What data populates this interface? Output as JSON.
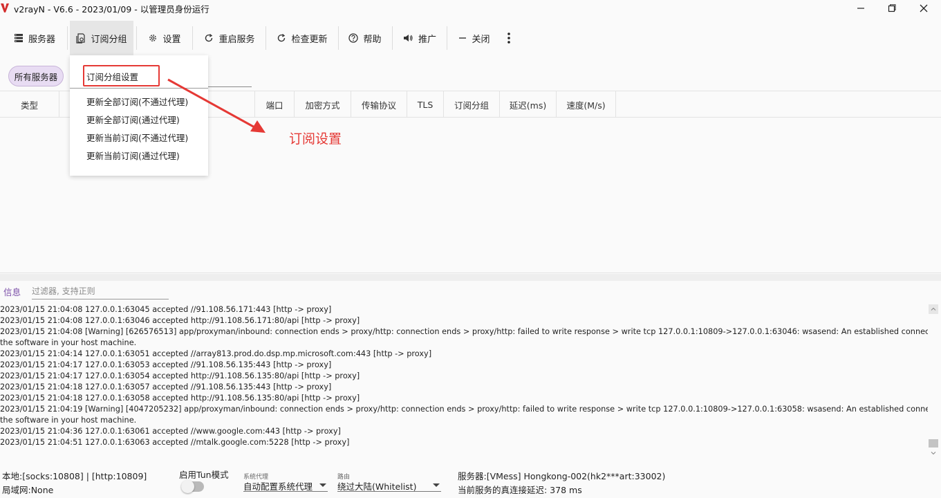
{
  "window": {
    "title": "v2rayN - V6.6 - 2023/01/09 - 以管理员身份运行"
  },
  "toolbar": {
    "items": [
      {
        "label": "服务器",
        "icon": "server-icon"
      },
      {
        "label": "订阅分组",
        "icon": "subscription-icon"
      },
      {
        "label": "设置",
        "icon": "gear-icon"
      },
      {
        "label": "重启服务",
        "icon": "restart-icon"
      },
      {
        "label": "检查更新",
        "icon": "update-icon"
      },
      {
        "label": "帮助",
        "icon": "help-icon"
      },
      {
        "label": "推广",
        "icon": "speaker-icon"
      },
      {
        "label": "关闭",
        "icon": "minus-icon"
      }
    ],
    "more_icon": "more-vertical-icon",
    "active_item": "订阅分组"
  },
  "group_chip": {
    "label": "所有服务器"
  },
  "subscription_menu": {
    "items": [
      "订阅分组设置",
      "更新全部订阅(不通过代理)",
      "更新全部订阅(通过代理)",
      "更新当前订阅(不通过代理)",
      "更新当前订阅(通过代理)"
    ],
    "highlight_color": "#e53935"
  },
  "annotation": {
    "text": "订阅设置",
    "color": "#e53935"
  },
  "server_table": {
    "columns": [
      "类型",
      "端口",
      "加密方式",
      "传输协议",
      "TLS",
      "订阅分组",
      "延迟(ms)",
      "速度(M/s)"
    ],
    "rows": []
  },
  "log_panel": {
    "tab_label": "信息",
    "filter_placeholder": "过滤器, 支持正则",
    "lines": [
      "2023/01/15 21:04:08 127.0.0.1:63045 accepted //91.108.56.171:443 [http -> proxy]",
      "2023/01/15 21:04:08 127.0.0.1:63046 accepted http://91.108.56.171:80/api [http -> proxy]",
      "2023/01/15 21:04:08 [Warning] [626576513] app/proxyman/inbound: connection ends > proxy/http: connection ends > proxy/http: failed to write response > write tcp 127.0.0.1:10809->127.0.0.1:63046: wsasend: An established connection was aborted by",
      "the software in your host machine.",
      "2023/01/15 21:04:14 127.0.0.1:63051 accepted //array813.prod.do.dsp.mp.microsoft.com:443 [http -> proxy]",
      "2023/01/15 21:04:17 127.0.0.1:63053 accepted //91.108.56.135:443 [http -> proxy]",
      "2023/01/15 21:04:17 127.0.0.1:63054 accepted http://91.108.56.135:80/api [http -> proxy]",
      "2023/01/15 21:04:18 127.0.0.1:63057 accepted //91.108.56.135:443 [http -> proxy]",
      "2023/01/15 21:04:18 127.0.0.1:63058 accepted http://91.108.56.135:80/api [http -> proxy]",
      "2023/01/15 21:04:19 [Warning] [4047205232] app/proxyman/inbound: connection ends > proxy/http: connection ends > proxy/http: failed to write response > write tcp 127.0.0.1:10809->127.0.0.1:63058: wsasend: An established connection was aborted by",
      "the software in your host machine.",
      "2023/01/15 21:04:36 127.0.0.1:63061 accepted //www.google.com:443 [http -> proxy]",
      "2023/01/15 21:04:51 127.0.0.1:63063 accepted //mtalk.google.com:5228 [http -> proxy]"
    ]
  },
  "status_bar": {
    "local_ports": "本地:[socks:10808] | [http:10809]",
    "lan": "局域网:None",
    "tun_label": "启用Tun模式",
    "tun_enabled": false,
    "system_proxy": {
      "caption": "系统代理",
      "value": "自动配置系统代理"
    },
    "routing": {
      "caption": "路由",
      "value": "绕过大陆(Whitelist)"
    },
    "server_info": "服务器:[VMess] Hongkong-002(hk2***art:33002)",
    "latency": "当前服务的真连接延迟: 378 ms"
  },
  "colors": {
    "accent_purple": "#7b4fa8",
    "chip_background": "#e8dcf3",
    "annotation_red": "#e53935",
    "logo_red": "#d32f2f"
  }
}
